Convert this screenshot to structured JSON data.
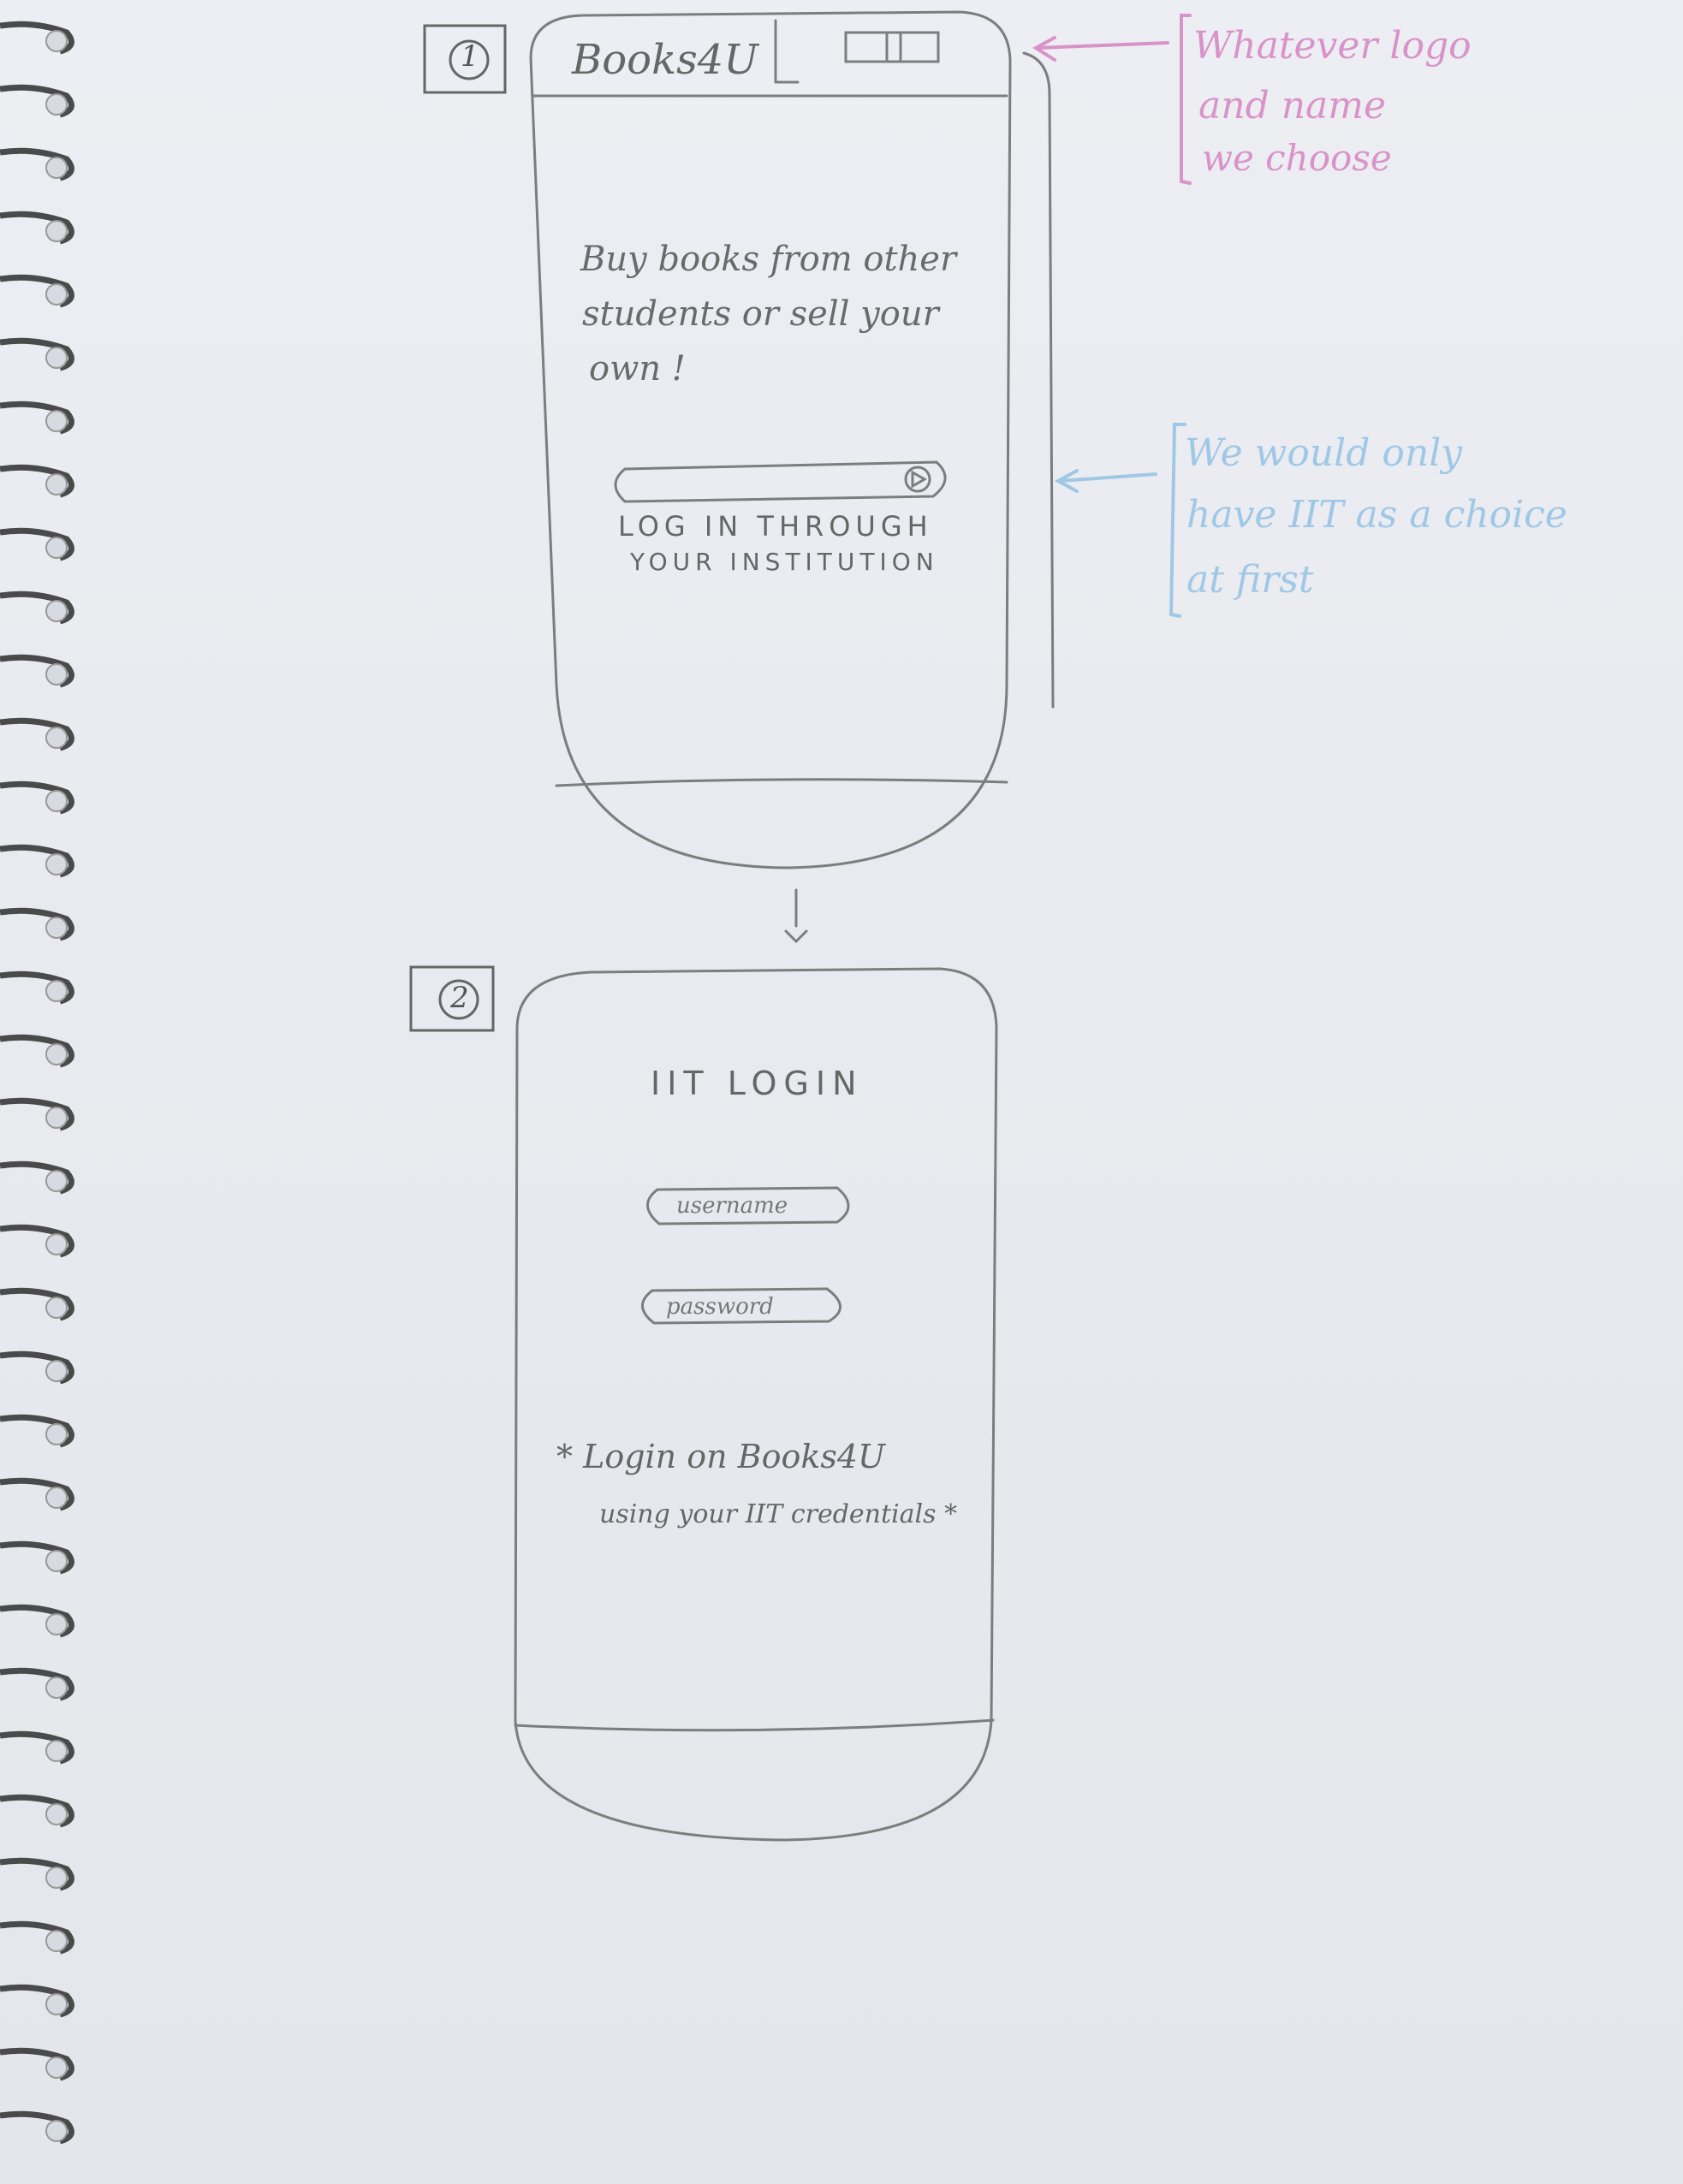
{
  "screen1": {
    "number": "1",
    "app_title": "Books4U",
    "tagline": [
      "Buy books from other",
      "students or sell your",
      "own !"
    ],
    "login_button": {
      "line1": "LOG IN THROUGH",
      "line2": "YOUR INSTITUTION"
    }
  },
  "screen2": {
    "number": "2",
    "title": "IIT LOGIN",
    "username_placeholder": "username",
    "password_placeholder": "password",
    "note": [
      "* Login on Books4U",
      "using your IIT credentials *"
    ]
  },
  "annotations": {
    "logo_note": {
      "lines": [
        "Whatever logo",
        "and name",
        "we choose"
      ],
      "color": "#d993c8"
    },
    "institution_note": {
      "lines": [
        "We would only",
        "have IIT as a choice",
        "at first"
      ],
      "color": "#9fc8e6"
    }
  },
  "colors": {
    "paper": "#e9ebf0",
    "pencil": "#7a7a7a",
    "spiral": "#4a4a4a"
  }
}
